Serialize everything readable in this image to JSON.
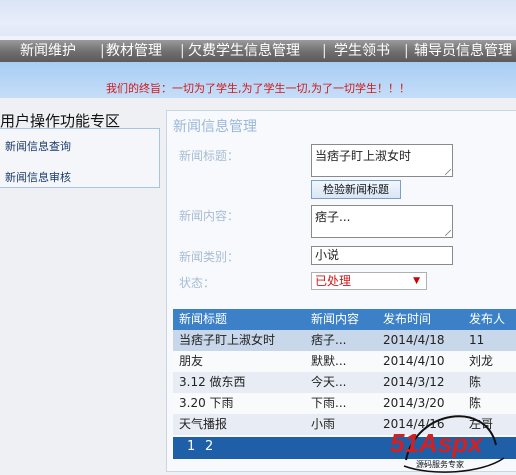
{
  "menu": {
    "items": [
      "新闻维护",
      "教材管理",
      "欠费学生信息管理",
      "学生领书",
      "辅导员信息管理"
    ],
    "separator": "|"
  },
  "motto": "我们的终旨：一切为了学生,为了学生一切,为了一切学生！！！",
  "sidebar": {
    "title": "用户操作功能专区",
    "items": [
      "新闻信息查询",
      "新闻信息审核"
    ]
  },
  "panel": {
    "title": "新闻信息管理",
    "fields": {
      "title_label": "新闻标题：",
      "title_value": "当痞子盯上淑女时",
      "check_button": "检验新闻标题",
      "content_label": "新闻内容：",
      "content_value": "痞子...",
      "category_label": "新闻类别：",
      "category_value": "小说",
      "status_label": "状态：",
      "status_value": "已处理"
    }
  },
  "table": {
    "headers": [
      "新闻标题",
      "新闻内容",
      "发布时间",
      "发布人"
    ],
    "rows": [
      [
        "当痞子盯上淑女时",
        "痞子...",
        "2014/4/18",
        "11"
      ],
      [
        "朋友",
        "默默...",
        "2014/4/10",
        "刘龙"
      ],
      [
        "3.12 做东西",
        "今天...",
        "2014/3/12",
        "陈"
      ],
      [
        "3.20 下雨",
        "下雨...",
        "2014/3/20",
        "陈"
      ],
      [
        "天气播报",
        "小雨",
        "2014/4/16",
        "左哥"
      ]
    ]
  },
  "pager": {
    "pages": [
      "1",
      "2"
    ]
  },
  "watermark": {
    "brand": "51Aspx",
    "tagline": "源码服务专家"
  },
  "colors": {
    "accent": "#3c80c8",
    "motto": "#d01818",
    "pager": "#1f5fa8"
  }
}
